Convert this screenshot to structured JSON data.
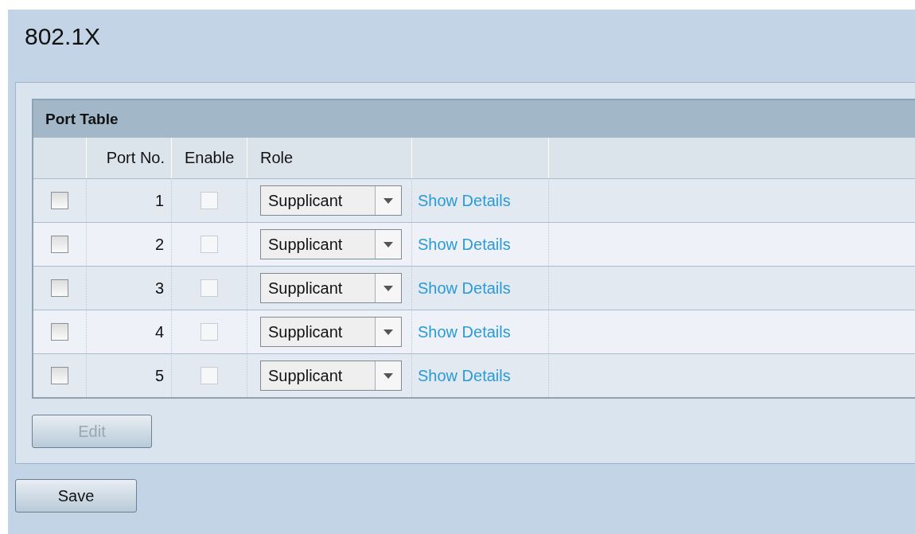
{
  "title": "802.1X",
  "port_table": {
    "title": "Port Table",
    "columns": [
      "Port No.",
      "Enable",
      "Role"
    ],
    "rows": [
      {
        "selected": false,
        "port": "1",
        "enable": {
          "checked": false,
          "disabled": true
        },
        "role": "Supplicant",
        "link": "Show Details"
      },
      {
        "selected": false,
        "port": "2",
        "enable": {
          "checked": false,
          "disabled": true
        },
        "role": "Supplicant",
        "link": "Show Details"
      },
      {
        "selected": false,
        "port": "3",
        "enable": {
          "checked": false,
          "disabled": true
        },
        "role": "Supplicant",
        "link": "Show Details"
      },
      {
        "selected": false,
        "port": "4",
        "enable": {
          "checked": false,
          "disabled": true
        },
        "role": "Supplicant",
        "link": "Show Details"
      },
      {
        "selected": false,
        "port": "5",
        "enable": {
          "checked": false,
          "disabled": true
        },
        "role": "Supplicant",
        "link": "Show Details"
      }
    ]
  },
  "edit_button": {
    "label": "Edit",
    "disabled": true
  },
  "save_button": {
    "label": "Save",
    "disabled": false
  }
}
